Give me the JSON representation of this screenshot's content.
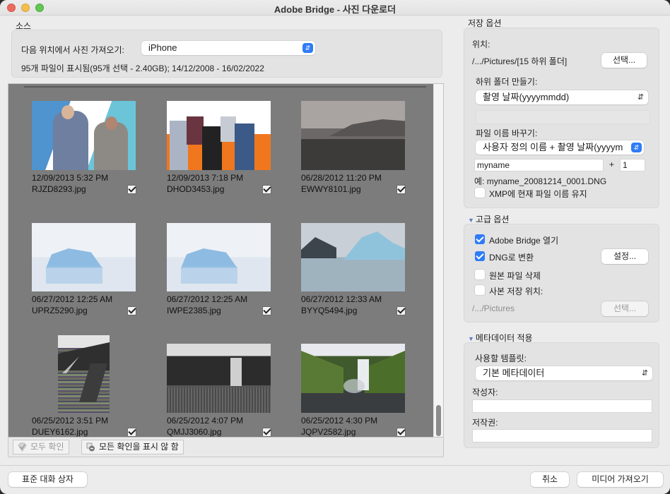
{
  "window": {
    "title": "Adobe Bridge - 사진 다운로더"
  },
  "source": {
    "section_label": "소스",
    "get_from_label": "다음 위치에서 사진 가져오기:",
    "get_from_value": "iPhone",
    "summary": "95개 파일이 표시됨(95개 선택 - 2.40GB); 14/12/2008 - 16/02/2022"
  },
  "thumbnails": [
    {
      "date": "12/09/2013 5:32 PM",
      "name": "RJZD8293.jpg",
      "checked": true,
      "image": "two-men-portrait"
    },
    {
      "date": "12/09/2013 7:18 PM",
      "name": "DHOD3453.jpg",
      "checked": true,
      "image": "band-group-photo"
    },
    {
      "date": "06/28/2012 11:20 PM",
      "name": "EWWY8101.jpg",
      "checked": true,
      "image": "bw-landscape"
    },
    {
      "date": "06/27/2012 12:25 AM",
      "name": "UPRZ5290.jpg",
      "checked": true,
      "image": "iceberg"
    },
    {
      "date": "06/27/2012 12:25 AM",
      "name": "IWPE2385.jpg",
      "checked": true,
      "image": "iceberg"
    },
    {
      "date": "06/27/2012 12:33 AM",
      "name": "BYYQ5494.jpg",
      "checked": true,
      "image": "iceberg-lagoon"
    },
    {
      "date": "06/25/2012 3:51 PM",
      "name": "DUEY6162.jpg",
      "checked": true,
      "image": "corrupted-waterfall"
    },
    {
      "date": "06/25/2012 4:07 PM",
      "name": "QMJJ3060.jpg",
      "checked": true,
      "image": "bw-waterfall"
    },
    {
      "date": "06/25/2012 4:30 PM",
      "name": "JQPV2582.jpg",
      "checked": true,
      "image": "green-waterfall"
    }
  ],
  "grid_toolbar": {
    "check_all": "모두 확인",
    "uncheck_all": "모든 확인을 표시 않 함"
  },
  "save_options": {
    "section_label": "저장 옵션",
    "location_label": "위치:",
    "location_value": "/.../Pictures/[15 하위 폴더]",
    "choose_button": "선택...",
    "subfolder_label": "하위 폴더 만들기:",
    "subfolder_value": "촬영 날짜(yyyymmdd)",
    "rename_label": "파일 이름 바꾸기:",
    "rename_value": "사용자 정의 이름 + 촬영 날짜(yyyym",
    "custom_name_value": "myname",
    "plus": "+",
    "sequence_value": "1",
    "example": "예:  myname_20081214_0001.DNG",
    "keep_xmp_label": "XMP에 현재 파일 이름 유지",
    "keep_xmp_checked": false
  },
  "advanced": {
    "section_label": "고급 옵션",
    "open_bridge_label": "Adobe Bridge 열기",
    "open_bridge_checked": true,
    "convert_dng_label": "DNG로 변환",
    "convert_dng_checked": true,
    "settings_button": "설정...",
    "delete_original_label": "원본 파일 삭제",
    "delete_original_checked": false,
    "save_copy_label": "사본 저장 위치:",
    "save_copy_checked": false,
    "copy_path": "/.../Pictures",
    "copy_choose_button": "선택..."
  },
  "metadata": {
    "section_label": "메타데이터 적용",
    "template_label": "사용할 템플릿:",
    "template_value": "기본 메타데이터",
    "creator_label": "작성자:",
    "creator_value": "",
    "copyright_label": "저작권:",
    "copyright_value": ""
  },
  "footer": {
    "standard_dialog": "표준 대화 상자",
    "cancel": "취소",
    "get_media": "미디어 가져오기"
  }
}
